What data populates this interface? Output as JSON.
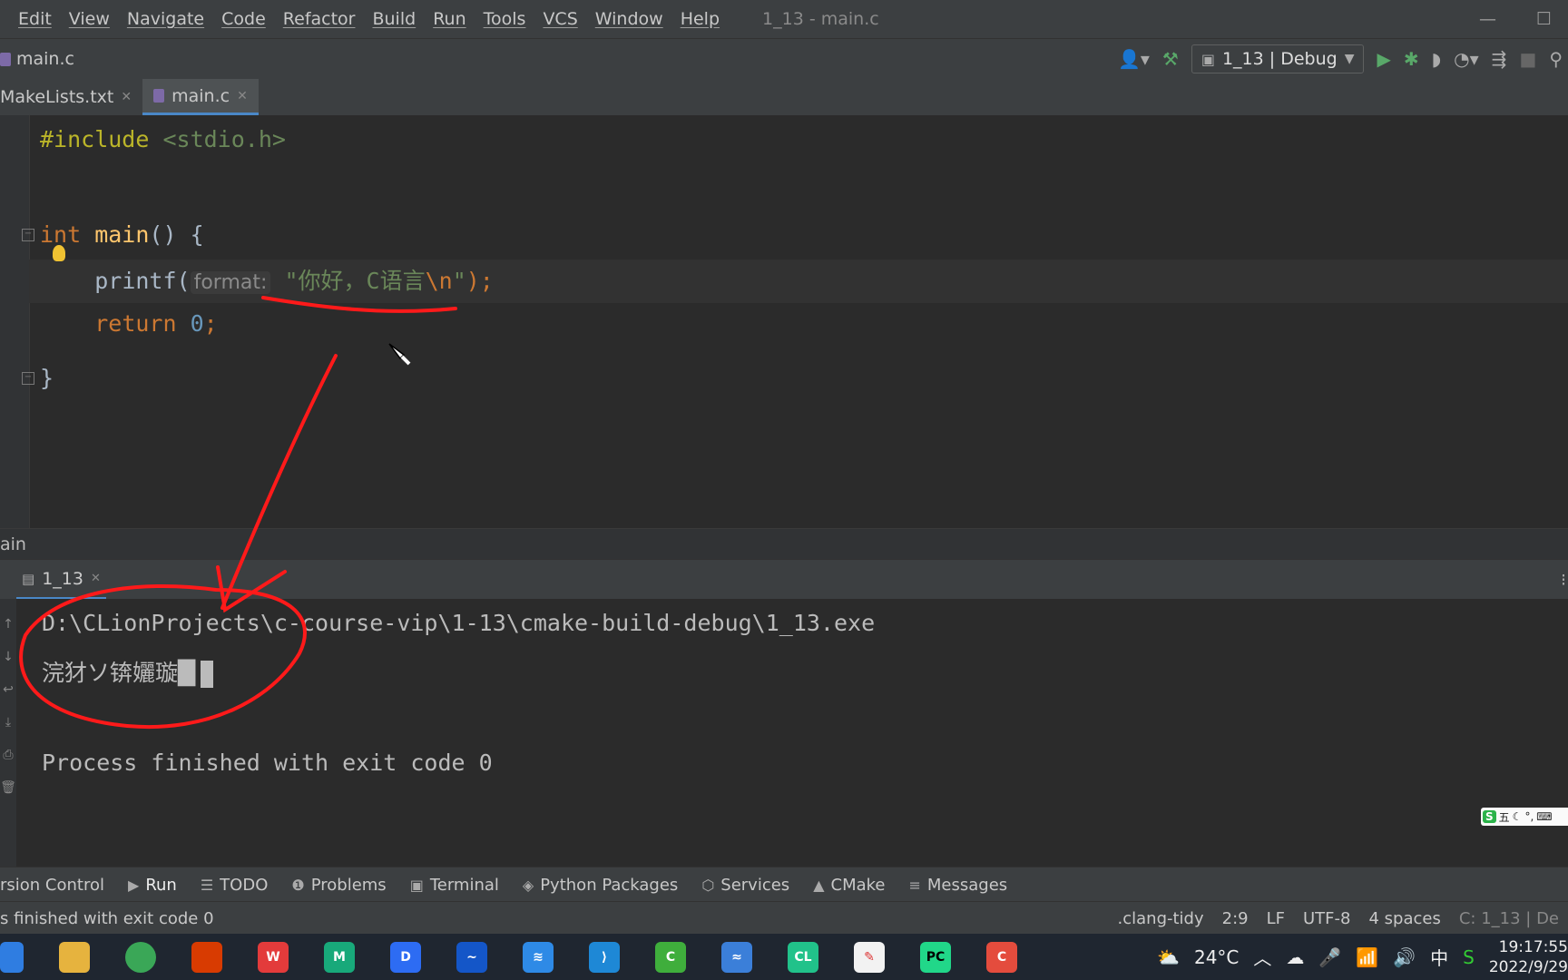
{
  "menubar": {
    "items": [
      "Edit",
      "View",
      "Navigate",
      "Code",
      "Refactor",
      "Build",
      "Run",
      "Tools",
      "VCS",
      "Window",
      "Help"
    ],
    "window_title": "1_13 - main.c"
  },
  "navbar": {
    "file": "main.c",
    "run_config": "1_13 | Debug"
  },
  "tabs": [
    {
      "label": "MakeLists.txt"
    },
    {
      "label": "main.c"
    }
  ],
  "editor": {
    "line1": {
      "directive": "#include",
      "header": " <stdio.h>"
    },
    "line3": {
      "type": "int",
      "fn": " main",
      "rest": "() {"
    },
    "line4": {
      "call": "printf(",
      "hint": "format:",
      "string_open": "\"你好，C语言",
      "escape": "\\n",
      "string_close": "\"",
      "end": ");"
    },
    "line5": {
      "kw": "return",
      "num": " 0",
      "end": ";"
    },
    "line6": "}"
  },
  "crumb_strip": "ain",
  "run_panel": {
    "tab": "1_13",
    "output": {
      "path": "D:\\CLionProjects\\c-course-vip\\1-13\\cmake-build-debug\\1_13.exe",
      "garbled": "浣犲ソ锛孋璇█",
      "finish": "Process finished with exit code 0"
    }
  },
  "tool_windows": [
    {
      "label": "rsion Control",
      "icon": "none"
    },
    {
      "label": "Run",
      "icon": "play-icon"
    },
    {
      "label": "TODO",
      "icon": "list-icon"
    },
    {
      "label": "Problems",
      "icon": "info-icon"
    },
    {
      "label": "Terminal",
      "icon": "terminal-icon"
    },
    {
      "label": "Python Packages",
      "icon": "layers-icon"
    },
    {
      "label": "Services",
      "icon": "services-icon"
    },
    {
      "label": "CMake",
      "icon": "triangle-icon"
    },
    {
      "label": "Messages",
      "icon": "messages-icon"
    }
  ],
  "status": {
    "left": "s finished with exit code 0",
    "right": [
      ".clang-tidy",
      "2:9",
      "LF",
      "UTF-8",
      "4 spaces",
      "C: 1_13 | De"
    ]
  },
  "taskbar": {
    "weather": "24°C",
    "ime": "中",
    "time": "19:17:55",
    "date": "2022/9/29"
  },
  "ime_toolbar": "五",
  "colors": {
    "background": "#2b2b2b",
    "annotation": "#ff1a1a",
    "keyword": "#cc7832",
    "string": "#6a8759"
  }
}
